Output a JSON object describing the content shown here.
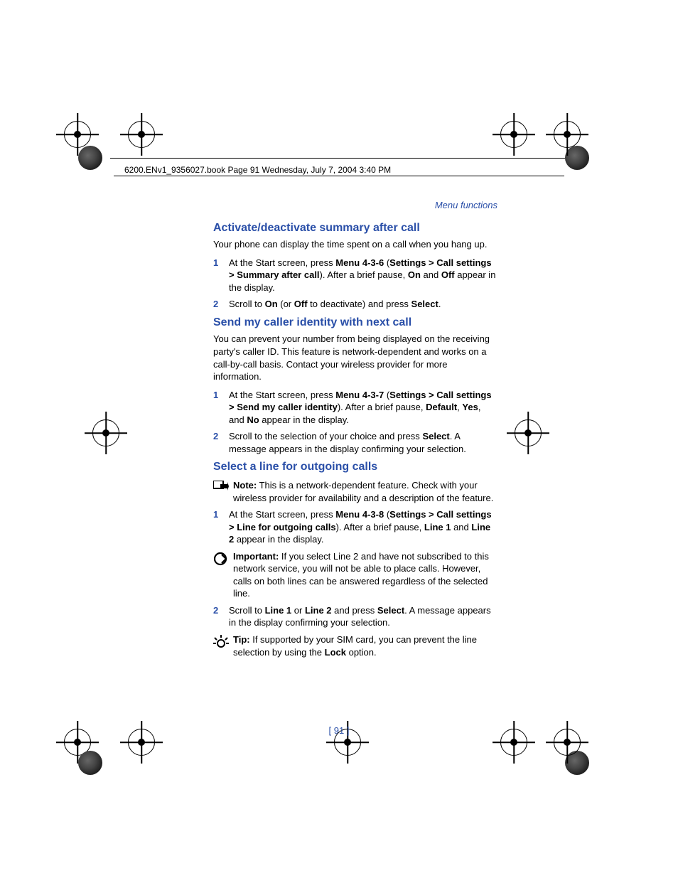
{
  "header_line": "6200.ENv1_9356027.book  Page 91  Wednesday, July 7, 2004  3:40 PM",
  "section_label": "Menu functions",
  "page_number": "[ 91 ]",
  "sections": [
    {
      "heading": "Activate/deactivate summary after call",
      "intro": "Your phone can display the time spent on a call when you hang up.",
      "steps": [
        {
          "num": "1",
          "parts": [
            "At the Start screen, press ",
            "Menu 4-3-6",
            " (",
            "Settings > Call settings > Summary after call",
            "). After a brief pause, ",
            "On",
            " and ",
            "Off",
            " appear in the display."
          ]
        },
        {
          "num": "2",
          "parts": [
            "Scroll to ",
            "On",
            " (or ",
            "Off",
            " to deactivate) and press ",
            "Select",
            "."
          ]
        }
      ]
    },
    {
      "heading": "Send my caller identity with next call",
      "intro": "You can prevent your number from being displayed on the receiving party's caller ID. This feature is network-dependent and works on a call-by-call basis. Contact your wireless provider for more information.",
      "steps": [
        {
          "num": "1",
          "parts": [
            "At the Start screen, press ",
            "Menu 4-3-7",
            " (",
            "Settings > Call settings > Send my caller identity",
            "). After a brief pause, ",
            "Default",
            ", ",
            "Yes",
            ", and ",
            "No",
            " appear in the display."
          ]
        },
        {
          "num": "2",
          "parts": [
            "Scroll to the selection of your choice and press ",
            "Select",
            ". A message appears in the display confirming your selection."
          ]
        }
      ]
    },
    {
      "heading": "Select a line for outgoing calls",
      "note": {
        "label": "Note:",
        "text": " This is a network-dependent feature. Check with your wireless provider for availability and a description of the feature."
      },
      "steps": [
        {
          "num": "1",
          "parts": [
            "At the Start screen, press ",
            "Menu 4-3-8",
            " (",
            "Settings > Call settings > Line for outgoing calls",
            "). After a brief pause, ",
            "Line 1",
            " and ",
            "Line 2",
            " appear in the display."
          ]
        }
      ],
      "important": {
        "label": "Important:",
        "text": " If you select Line 2 and have not subscribed to this network service, you will not be able to place calls. However, calls on both lines can be answered regardless of the selected line."
      },
      "steps2": [
        {
          "num": "2",
          "parts": [
            "Scroll to ",
            "Line 1",
            " or ",
            "Line 2",
            " and press ",
            "Select",
            ". A message appears in the display confirming your selection."
          ]
        }
      ],
      "tip": {
        "label": "Tip:",
        "text_before": " If supported by your SIM card, you can prevent the line selection by using the ",
        "bold": "Lock",
        "text_after": " option."
      }
    }
  ]
}
